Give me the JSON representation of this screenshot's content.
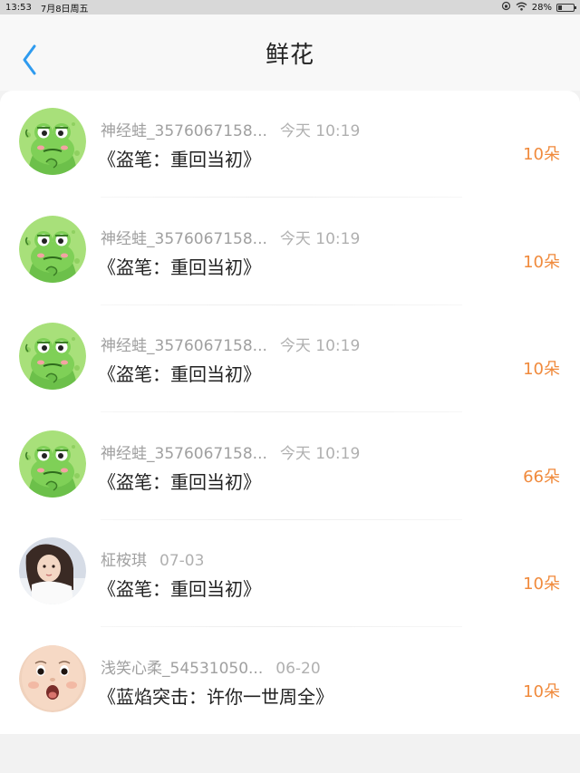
{
  "status_bar": {
    "time": "13:53",
    "date": "7月8日周五",
    "battery": "28%",
    "battery_level": 0.28
  },
  "header": {
    "title": "鲜花",
    "back_icon": "chevron-left-icon"
  },
  "colors": {
    "accent": "#2f9bef",
    "count": "#f08a3c"
  },
  "items": [
    {
      "user": "神经蛙_3576067158...",
      "time": "今天 10:19",
      "book": "《盗笔：重回当初》",
      "count": "10朵",
      "avatar": "frog"
    },
    {
      "user": "神经蛙_3576067158...",
      "time": "今天 10:19",
      "book": "《盗笔：重回当初》",
      "count": "10朵",
      "avatar": "frog"
    },
    {
      "user": "神经蛙_3576067158...",
      "time": "今天 10:19",
      "book": "《盗笔：重回当初》",
      "count": "10朵",
      "avatar": "frog"
    },
    {
      "user": "神经蛙_3576067158...",
      "time": "今天 10:19",
      "book": "《盗笔：重回当初》",
      "count": "66朵",
      "avatar": "frog"
    },
    {
      "user": "柾桉琪",
      "time": "07-03",
      "book": "《盗笔：重回当初》",
      "count": "10朵",
      "avatar": "girl-photo"
    },
    {
      "user": "浅笑心柔_54531050...",
      "time": "06-20",
      "book": "《蓝焰突击：许你一世周全》",
      "count": "10朵",
      "avatar": "baby-photo"
    }
  ]
}
